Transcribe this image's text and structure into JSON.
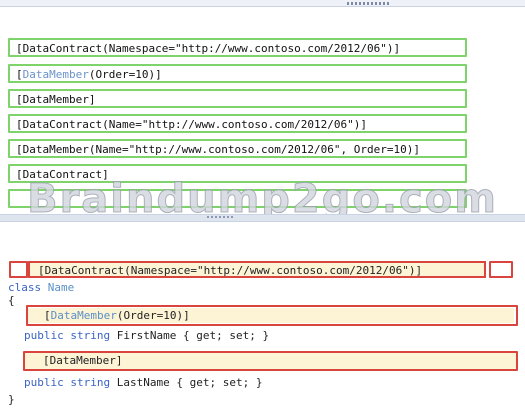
{
  "watermark": "Braindump2go.com",
  "options": [
    {
      "prefix": "[DataContract(Namespace=",
      "value": "\"http://www.contoso.com/2012/06\"",
      "suffix": ")]"
    },
    {
      "prefix": "[",
      "attr": "DataMember",
      "args": "(Order=10)]"
    },
    {
      "text": "[DataMember]"
    },
    {
      "prefix": "[DataContract(Name=",
      "value": "\"http://www.contoso.com/2012/06\"",
      "suffix": ")]"
    },
    {
      "prefix": "[DataMember(Name=",
      "value": "\"http://www.contoso.com/2012/06\"",
      "suffix": ", Order=10)]"
    },
    {
      "text": "[DataContract]"
    }
  ],
  "code": {
    "class_kw": "class",
    "class_name": "Name",
    "open_brace": "{",
    "close_brace": "}",
    "slot1": "[DataContract(Namespace=\"http://www.contoso.com/2012/06\")]",
    "slot2_attr": "DataMember",
    "slot2_args": "(Order=10)]",
    "slot2_open": "[",
    "line_first": "public string FirstName { get; set; }",
    "slot3": "[DataMember]",
    "line_last": "public string LastName { get; set; }"
  }
}
